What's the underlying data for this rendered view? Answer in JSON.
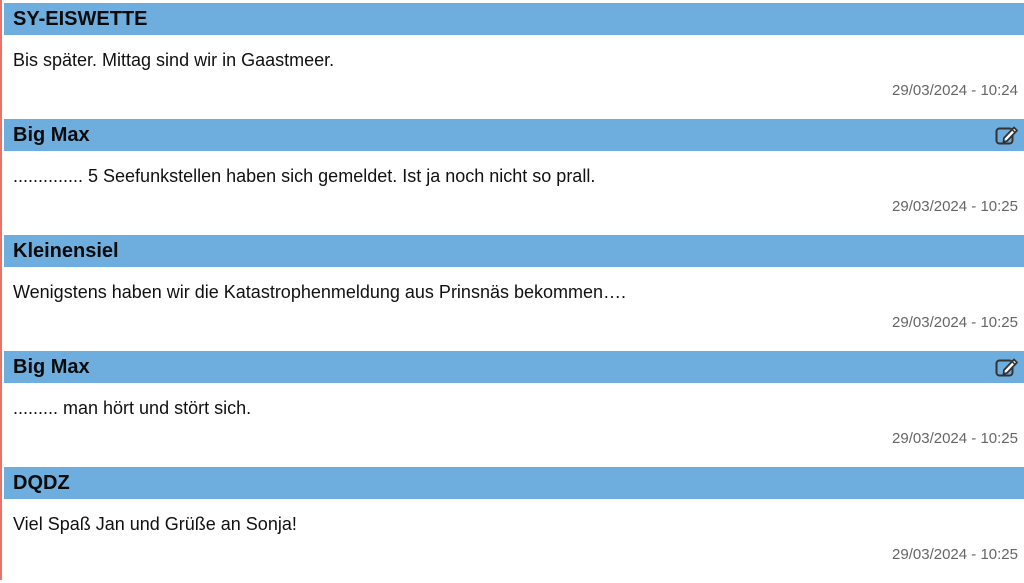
{
  "messages": [
    {
      "author": "SY-EISWETTE",
      "text": "Bis später. Mittag sind wir in Gaastmeer.",
      "timestamp": "29/03/2024 - 10:24",
      "editable": false
    },
    {
      "author": "Big Max",
      "text": ".............. 5 Seefunkstellen haben sich gemeldet. Ist ja noch nicht so prall.",
      "timestamp": "29/03/2024 - 10:25",
      "editable": true,
      "icon": "edit-icon"
    },
    {
      "author": "Kleinensiel",
      "text": "Wenigstens haben wir die Katastrophenmeldung aus Prinsnäs bekommen….",
      "timestamp": "29/03/2024 - 10:25",
      "editable": false
    },
    {
      "author": "Big Max",
      "text": "......... man hört und stört sich.",
      "timestamp": "29/03/2024 - 10:25",
      "editable": true,
      "icon": "edit-icon"
    },
    {
      "author": "DQDZ",
      "text": "Viel Spaß Jan und Grüße an Sonja!",
      "timestamp": "29/03/2024 - 10:25",
      "editable": false
    }
  ],
  "colors": {
    "header_bg": "#6eaedf",
    "left_border": "#e8736a",
    "timestamp": "#666666"
  }
}
